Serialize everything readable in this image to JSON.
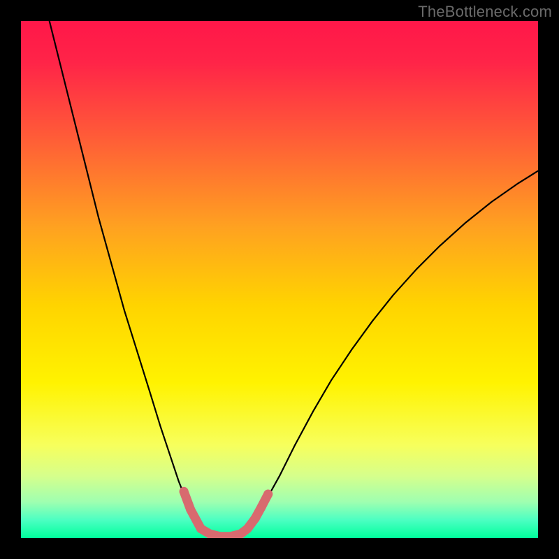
{
  "watermark": "TheBottleneck.com",
  "chart_data": {
    "type": "line",
    "title": "",
    "xlabel": "",
    "ylabel": "",
    "xlim": [
      0,
      100
    ],
    "ylim": [
      0,
      100
    ],
    "gradient_stops": [
      {
        "offset": 0.0,
        "color": "#ff1749"
      },
      {
        "offset": 0.08,
        "color": "#ff2448"
      },
      {
        "offset": 0.22,
        "color": "#ff5a38"
      },
      {
        "offset": 0.4,
        "color": "#ffa220"
      },
      {
        "offset": 0.55,
        "color": "#ffd400"
      },
      {
        "offset": 0.7,
        "color": "#fff300"
      },
      {
        "offset": 0.82,
        "color": "#f7ff5c"
      },
      {
        "offset": 0.88,
        "color": "#d6ff8c"
      },
      {
        "offset": 0.93,
        "color": "#9fffb0"
      },
      {
        "offset": 0.965,
        "color": "#4cffc2"
      },
      {
        "offset": 1.0,
        "color": "#00ff9c"
      }
    ],
    "series": [
      {
        "name": "bottleneck-curve",
        "stroke": "#000000",
        "stroke_width": 2.2,
        "points": [
          {
            "x": 5.0,
            "y": 102.0
          },
          {
            "x": 6.5,
            "y": 96.0
          },
          {
            "x": 8.0,
            "y": 90.0
          },
          {
            "x": 10.0,
            "y": 82.0
          },
          {
            "x": 12.5,
            "y": 72.0
          },
          {
            "x": 15.0,
            "y": 62.0
          },
          {
            "x": 17.5,
            "y": 53.0
          },
          {
            "x": 20.0,
            "y": 44.0
          },
          {
            "x": 22.5,
            "y": 36.0
          },
          {
            "x": 25.0,
            "y": 28.0
          },
          {
            "x": 27.0,
            "y": 21.5
          },
          {
            "x": 29.0,
            "y": 15.5
          },
          {
            "x": 30.5,
            "y": 11.0
          },
          {
            "x": 32.0,
            "y": 7.2
          },
          {
            "x": 33.0,
            "y": 5.0
          },
          {
            "x": 34.2,
            "y": 3.0
          },
          {
            "x": 35.5,
            "y": 1.5
          },
          {
            "x": 37.0,
            "y": 0.6
          },
          {
            "x": 38.5,
            "y": 0.25
          },
          {
            "x": 40.0,
            "y": 0.25
          },
          {
            "x": 41.5,
            "y": 0.6
          },
          {
            "x": 43.0,
            "y": 1.5
          },
          {
            "x": 44.5,
            "y": 3.0
          },
          {
            "x": 46.0,
            "y": 5.0
          },
          {
            "x": 47.5,
            "y": 7.5
          },
          {
            "x": 50.0,
            "y": 12.0
          },
          {
            "x": 53.0,
            "y": 18.0
          },
          {
            "x": 56.5,
            "y": 24.5
          },
          {
            "x": 60.0,
            "y": 30.5
          },
          {
            "x": 64.0,
            "y": 36.5
          },
          {
            "x": 68.0,
            "y": 42.0
          },
          {
            "x": 72.0,
            "y": 47.0
          },
          {
            "x": 76.5,
            "y": 52.0
          },
          {
            "x": 81.0,
            "y": 56.5
          },
          {
            "x": 86.0,
            "y": 61.0
          },
          {
            "x": 91.0,
            "y": 65.0
          },
          {
            "x": 96.0,
            "y": 68.5
          },
          {
            "x": 100.0,
            "y": 71.0
          }
        ]
      },
      {
        "name": "bottom-markers",
        "stroke": "#d86a6f",
        "marker_r": 6.5,
        "points": [
          {
            "x": 31.5,
            "y": 9.0
          },
          {
            "x": 32.8,
            "y": 5.5
          },
          {
            "x": 34.8,
            "y": 1.8
          },
          {
            "x": 36.5,
            "y": 0.8
          },
          {
            "x": 38.5,
            "y": 0.3
          },
          {
            "x": 40.5,
            "y": 0.3
          },
          {
            "x": 42.5,
            "y": 0.8
          },
          {
            "x": 43.8,
            "y": 1.8
          },
          {
            "x": 45.3,
            "y": 3.8
          },
          {
            "x": 46.5,
            "y": 6.0
          },
          {
            "x": 47.8,
            "y": 8.5
          }
        ]
      }
    ]
  }
}
